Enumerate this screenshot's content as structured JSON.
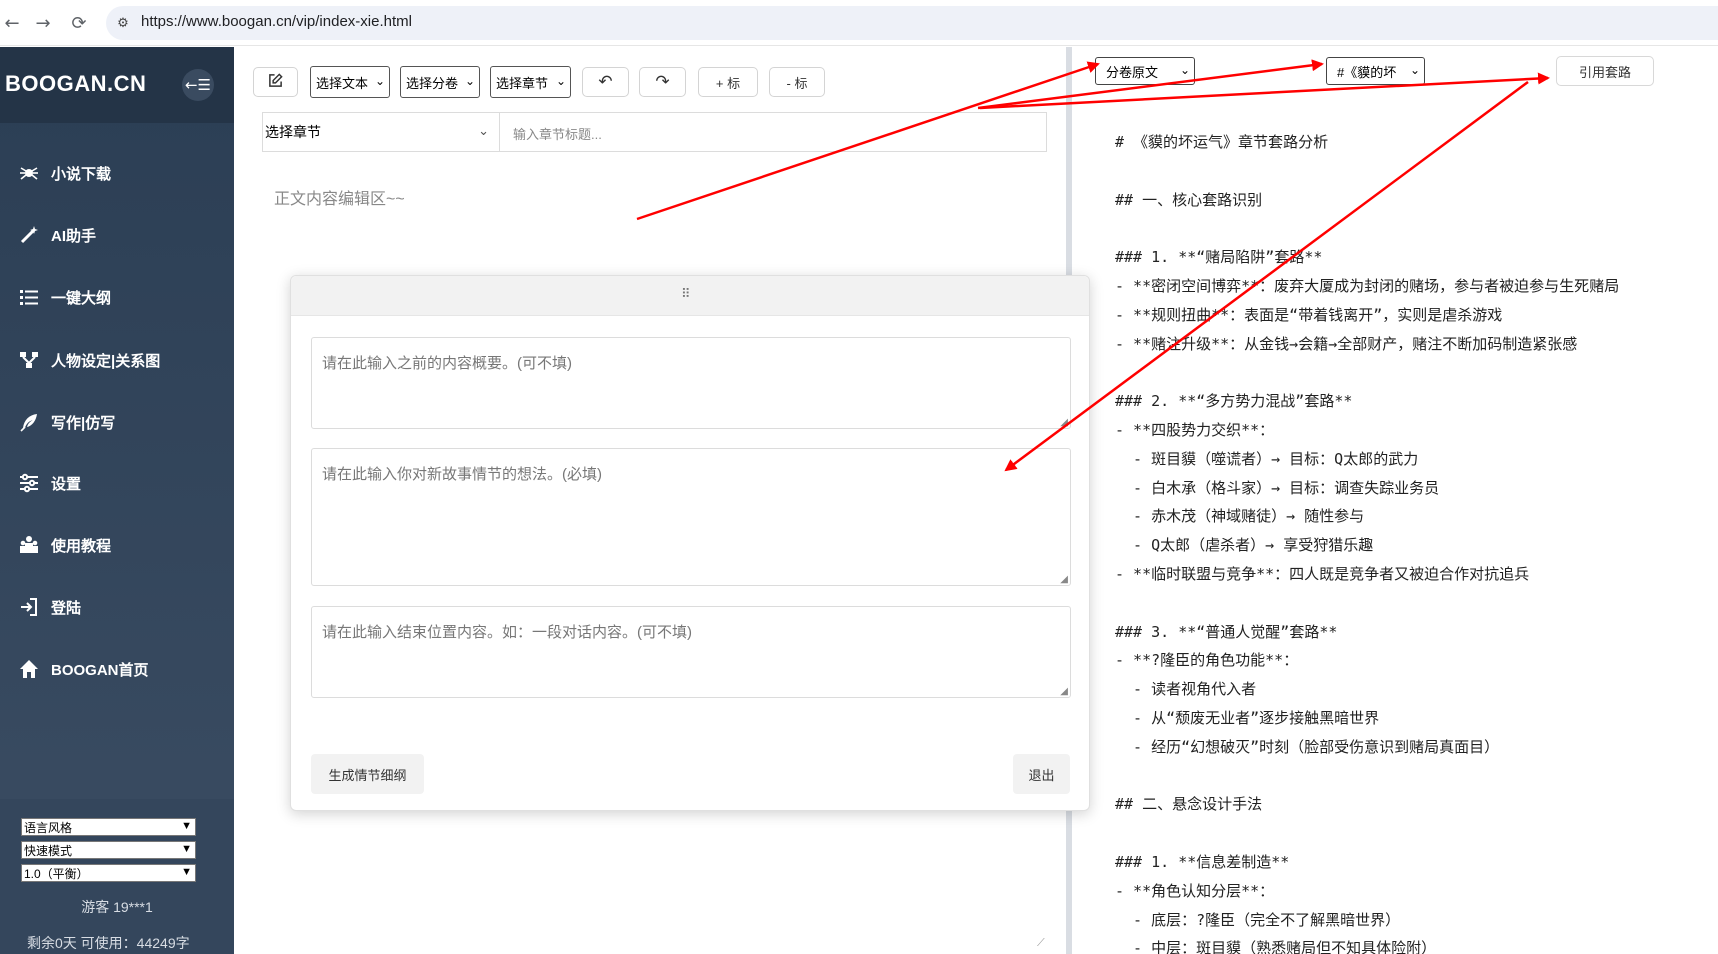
{
  "browser": {
    "url": "https://www.boogan.cn/vip/index-xie.html"
  },
  "sidebar": {
    "logo": "BOOGAN.CN",
    "toggle": "←☰",
    "items": [
      {
        "label": "小说下载",
        "icon": "spider-icon"
      },
      {
        "label": "AI助手",
        "icon": "magic-wand-icon"
      },
      {
        "label": "一键大纲",
        "icon": "list-icon"
      },
      {
        "label": "人物设定|关系图",
        "icon": "sitemap-icon"
      },
      {
        "label": "写作|仿写",
        "icon": "feather-icon"
      },
      {
        "label": "设置",
        "icon": "sliders-icon"
      },
      {
        "label": "使用教程",
        "icon": "users-icon"
      },
      {
        "label": "登陆",
        "icon": "sign-in-icon"
      },
      {
        "label": "BOOGAN首页",
        "icon": "home-icon"
      }
    ],
    "selects": [
      "语言风格",
      "快速模式",
      "1.0（平衡）"
    ],
    "guest": "游客 19***1",
    "remaining": "剩余0天 可使用：44249字"
  },
  "toolbar": {
    "select_text": "选择文本",
    "select_volume": "选择分卷",
    "select_chapter": "选择章节",
    "add_mark": "+ 标",
    "remove_mark": "- 标"
  },
  "editor": {
    "chapter_select": "选择章节",
    "chapter_title_placeholder": "输入章节标题...",
    "body_placeholder": "正文内容编辑区~~"
  },
  "modal": {
    "handle": "⠿",
    "summary_placeholder": "请在此输入之前的内容概要。(可不填)",
    "idea_placeholder": "请在此输入你对新故事情节的想法。(必填)",
    "ending_placeholder": "请在此输入结束位置内容。如：一段对话内容。(可不填)",
    "generate_button": "生成情节细纲",
    "exit_button": "退出"
  },
  "right_panel": {
    "source_select": "分卷原文",
    "chapter_select": "#《貘的坏",
    "cite_button": "引用套路",
    "lines": [
      "# 《貘的坏运气》章节套路分析",
      "",
      "## 一、核心套路识别",
      "",
      "### 1. **“赌局陷阱”套路**",
      "- **密闭空间博弈**：废弃大厦成为封闭的赌场，参与者被迫参与生死赌局",
      "- **规则扭曲**：表面是“带着钱离开”，实则是虐杀游戏",
      "- **赌注升级**：从金钱→会籍→全部财产，赌注不断加码制造紧张感",
      "",
      "### 2. **“多方势力混战”套路**",
      "- **四股势力交织**：",
      "  - 斑目貘（噬谎者）→ 目标：Q太郎的武力",
      "  - 白木承（格斗家）→ 目标：调查失踪业务员",
      "  - 赤木茂（神域赌徒）→ 随性参与",
      "  - Q太郎（虐杀者）→ 享受狩猎乐趣",
      "- **临时联盟与竞争**：四人既是竞争者又被迫合作对抗追兵",
      "",
      "### 3. **“普通人觉醒”套路**",
      "- **?隆臣的角色功能**：",
      "  - 读者视角代入者",
      "  - 从“颓废无业者”逐步接触黑暗世界",
      "  - 经历“幻想破灭”时刻（脸部受伤意识到赌局真面目）",
      "",
      "## 二、悬念设计手法",
      "",
      "### 1. **信息差制造**",
      "- **角色认知分层**：",
      "  - 底层：?隆臣（完全不了解黑暗世界）",
      "  - 中层：斑目貘（熟悉赌局但不知具体险附）"
    ]
  },
  "colors": {
    "sidebar": "#2b3e54",
    "annotation": "#ff0000"
  }
}
